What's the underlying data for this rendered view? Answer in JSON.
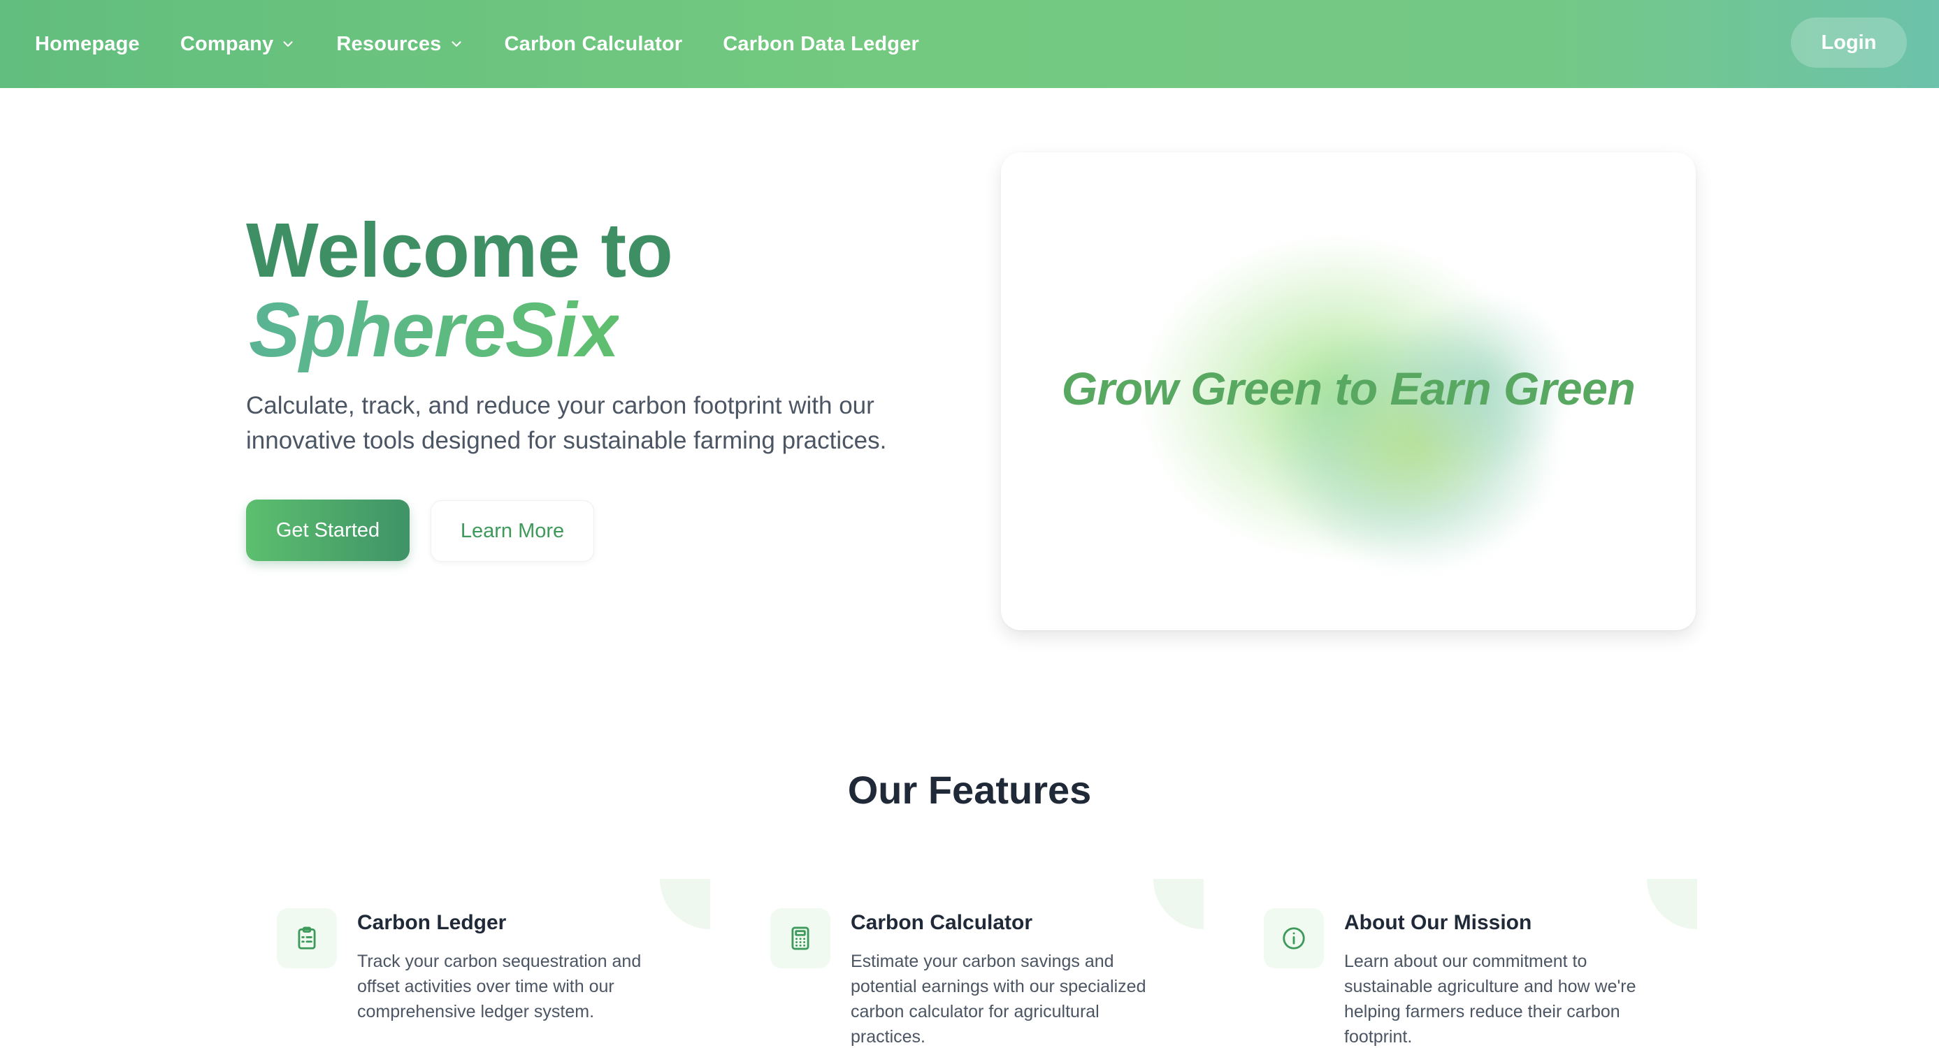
{
  "nav": {
    "items": [
      {
        "label": "Homepage"
      },
      {
        "label": "Company",
        "has_dropdown": true
      },
      {
        "label": "Resources",
        "has_dropdown": true
      },
      {
        "label": "Carbon Calculator"
      },
      {
        "label": "Carbon Data Ledger"
      }
    ],
    "login_label": "Login"
  },
  "hero": {
    "title_line1": "Welcome to",
    "title_brand": "SphereSix",
    "description": "Calculate, track, and reduce your carbon footprint with our innovative tools designed for sustainable farming practices.",
    "primary_button": "Get Started",
    "secondary_button": "Learn More",
    "card_tagline": "Grow Green to Earn Green"
  },
  "features": {
    "heading": "Our Features",
    "items": [
      {
        "icon": "clipboard-icon",
        "title": "Carbon Ledger",
        "description": "Track your carbon sequestration and offset activities over time with our comprehensive ledger system."
      },
      {
        "icon": "calculator-icon",
        "title": "Carbon Calculator",
        "description": "Estimate your carbon savings and potential earnings with our specialized carbon calculator for agricultural practices."
      },
      {
        "icon": "info-icon",
        "title": "About Our Mission",
        "description": "Learn about our commitment to sustainable agriculture and how we're helping farmers reduce their carbon footprint."
      }
    ]
  },
  "colors": {
    "brand_green": "#3e8f64",
    "accent_green": "#5cbf6e",
    "tagline_green": "#58a862",
    "nav_gradient_start": "#62be7e",
    "nav_gradient_end": "#6cc2aa"
  }
}
